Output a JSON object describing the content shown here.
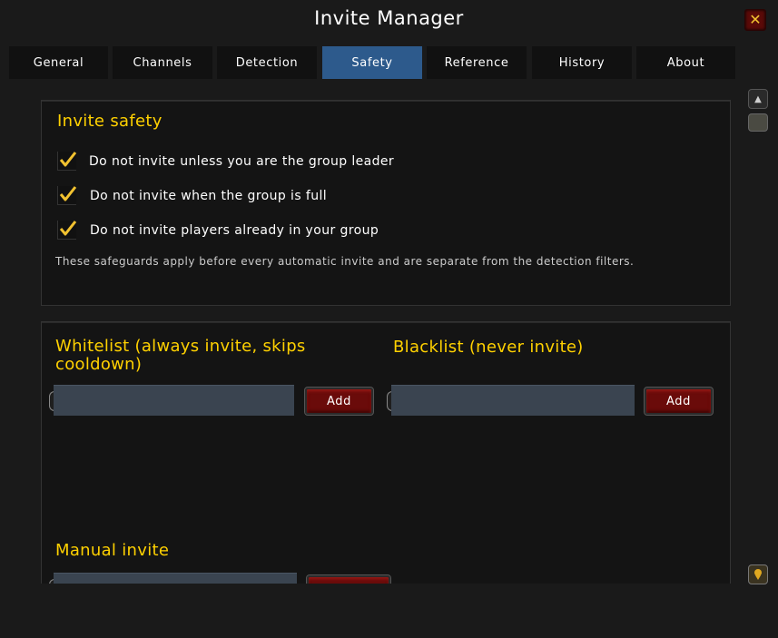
{
  "window": {
    "title": "Invite Manager"
  },
  "tabs": [
    {
      "label": "General"
    },
    {
      "label": "Channels"
    },
    {
      "label": "Detection"
    },
    {
      "label": "Safety"
    },
    {
      "label": "Reference"
    },
    {
      "label": "History"
    },
    {
      "label": "About"
    }
  ],
  "active_tab": "Safety",
  "safety": {
    "heading": "Invite safety",
    "options": [
      {
        "label": "Do not invite unless you are the group leader",
        "checked": true
      },
      {
        "label": "Do not invite when the group is full",
        "checked": true
      },
      {
        "label": "Do not invite players already in your group",
        "checked": true
      }
    ],
    "note": "These safeguards apply before every automatic invite and are separate from the detection filters."
  },
  "whitelist": {
    "heading": "Whitelist (always invite, skips cooldown)",
    "input_value": "",
    "add_label": "Add"
  },
  "blacklist": {
    "heading": "Blacklist (never invite)",
    "input_value": "",
    "add_label": "Add"
  },
  "manual_invite": {
    "heading": "Manual invite",
    "input_value": ""
  },
  "icons": {
    "close": "close-icon",
    "check": "checkmark-icon",
    "scroll_up": "scroll-up-icon",
    "scroll_down": "scroll-down-icon"
  },
  "colors": {
    "accent_gold": "#ffd100",
    "active_tab": "#2d5a8c",
    "button_red": "#6a0b0a",
    "input_bg": "#3a4450"
  }
}
